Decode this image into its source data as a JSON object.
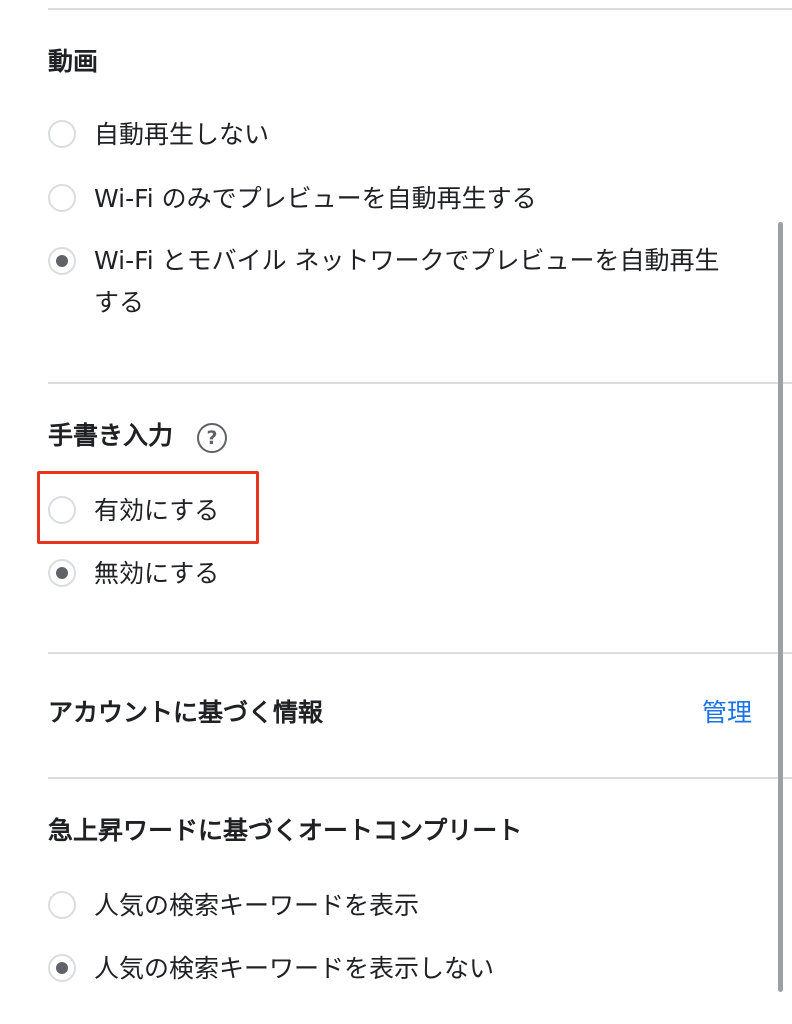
{
  "video": {
    "title": "動画",
    "options": [
      {
        "label": "自動再生しない",
        "selected": false
      },
      {
        "label": "Wi-Fi のみでプレビューを自動再生する",
        "selected": false
      },
      {
        "label": "Wi-Fi とモバイル ネットワークでプレビューを自動再生する",
        "selected": true
      }
    ]
  },
  "handwriting": {
    "title": "手書き入力",
    "help_icon": "question-circle-icon",
    "options": [
      {
        "label": "有効にする",
        "selected": false
      },
      {
        "label": "無効にする",
        "selected": true
      }
    ]
  },
  "account_info": {
    "title": "アカウントに基づく情報",
    "manage_label": "管理"
  },
  "trending": {
    "title": "急上昇ワードに基づくオートコンプリート",
    "options": [
      {
        "label": "人気の検索キーワードを表示",
        "selected": false
      },
      {
        "label": "人気の検索キーワードを表示しない",
        "selected": true
      }
    ]
  },
  "colors": {
    "accent_link": "#1a73e8",
    "highlight": "#e8341c",
    "radio_checked": "#5f6368",
    "divider": "#dadce0"
  }
}
